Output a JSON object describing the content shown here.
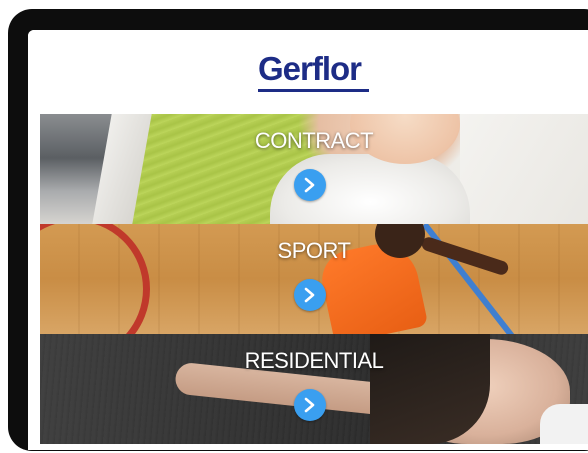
{
  "brand": {
    "logo_text": "Gerflor",
    "logo_color": "#1d2c86"
  },
  "panels": [
    {
      "title": "CONTRACT",
      "button_icon": "chevron-right-icon",
      "button_color": "#3a9ff0"
    },
    {
      "title": "SPORT",
      "button_icon": "chevron-right-icon",
      "button_color": "#3a9ff0"
    },
    {
      "title": "RESIDENTIAL",
      "button_icon": "chevron-right-icon",
      "button_color": "#3a9ff0"
    }
  ]
}
